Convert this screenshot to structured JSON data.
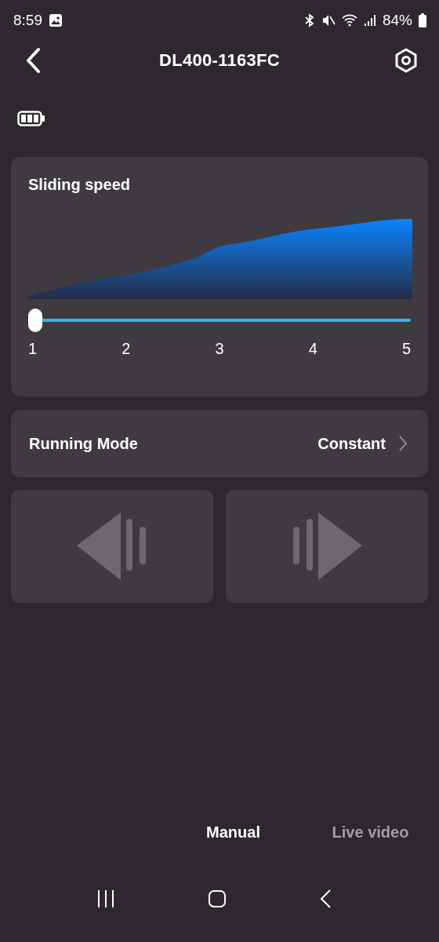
{
  "status_bar": {
    "time": "8:59",
    "battery": "84%"
  },
  "header": {
    "title": "DL400-1163FC"
  },
  "speed_card": {
    "title": "Sliding speed",
    "slider": {
      "level": 0
    },
    "ticks": [
      "1",
      "2",
      "3",
      "4",
      "5"
    ]
  },
  "running_mode": {
    "label": "Running Mode",
    "value": "Constant"
  },
  "tabs": [
    {
      "label": "Manual",
      "selected": true
    },
    {
      "label": "Live video",
      "selected": false
    }
  ]
}
